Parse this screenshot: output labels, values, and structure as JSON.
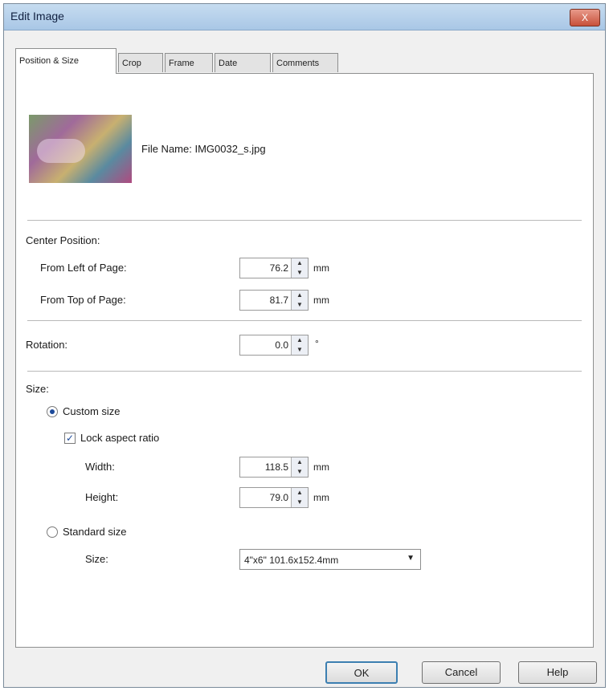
{
  "window": {
    "title": "Edit Image",
    "close_label": "X"
  },
  "tabs": [
    {
      "label": "Position & Size",
      "active": true
    },
    {
      "label": "Crop"
    },
    {
      "label": "Frame"
    },
    {
      "label": "Date"
    },
    {
      "label": "Comments"
    }
  ],
  "file": {
    "name_label": "File Name:",
    "name_value": "IMG0032_s.jpg"
  },
  "center_position": {
    "heading": "Center Position:",
    "from_left_label": "From Left of Page:",
    "from_left_value": "76.2",
    "from_top_label": "From Top of Page:",
    "from_top_value": "81.7",
    "unit": "mm"
  },
  "rotation": {
    "label": "Rotation:",
    "value": "0.0",
    "unit": "°"
  },
  "size": {
    "heading": "Size:",
    "custom_label": "Custom size",
    "custom_selected": true,
    "lock_label": "Lock aspect ratio",
    "lock_checked": true,
    "width_label": "Width:",
    "width_value": "118.5",
    "height_label": "Height:",
    "height_value": "79.0",
    "unit": "mm",
    "standard_label": "Standard size",
    "standard_selected": false,
    "size_label": "Size:",
    "size_value": "4\"x6\" 101.6x152.4mm"
  },
  "buttons": {
    "ok": "OK",
    "cancel": "Cancel",
    "help": "Help"
  },
  "colors": {
    "titlebar": "#b7d2ec",
    "accent": "#1d4a9a"
  }
}
